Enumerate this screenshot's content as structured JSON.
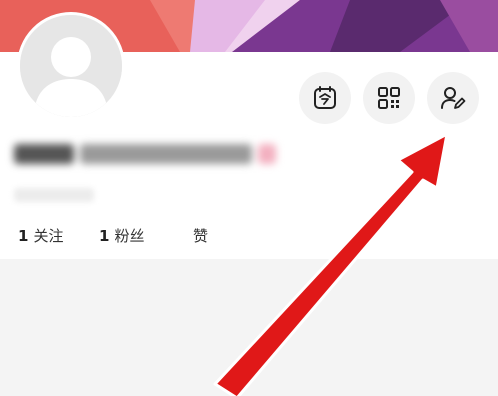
{
  "profile": {
    "stats": [
      {
        "count": "1",
        "label": "关注"
      },
      {
        "count": "1",
        "label": "粉丝"
      },
      {
        "count": "",
        "label": "赞"
      }
    ]
  },
  "header_icons": [
    "calendar-today-icon",
    "qr-code-icon",
    "edit-profile-icon"
  ],
  "colors": {
    "banner_red": "#e8615a",
    "banner_pink": "#e5b8e6",
    "banner_purple": "#8b3a8f",
    "arrow_red": "#e01818"
  }
}
